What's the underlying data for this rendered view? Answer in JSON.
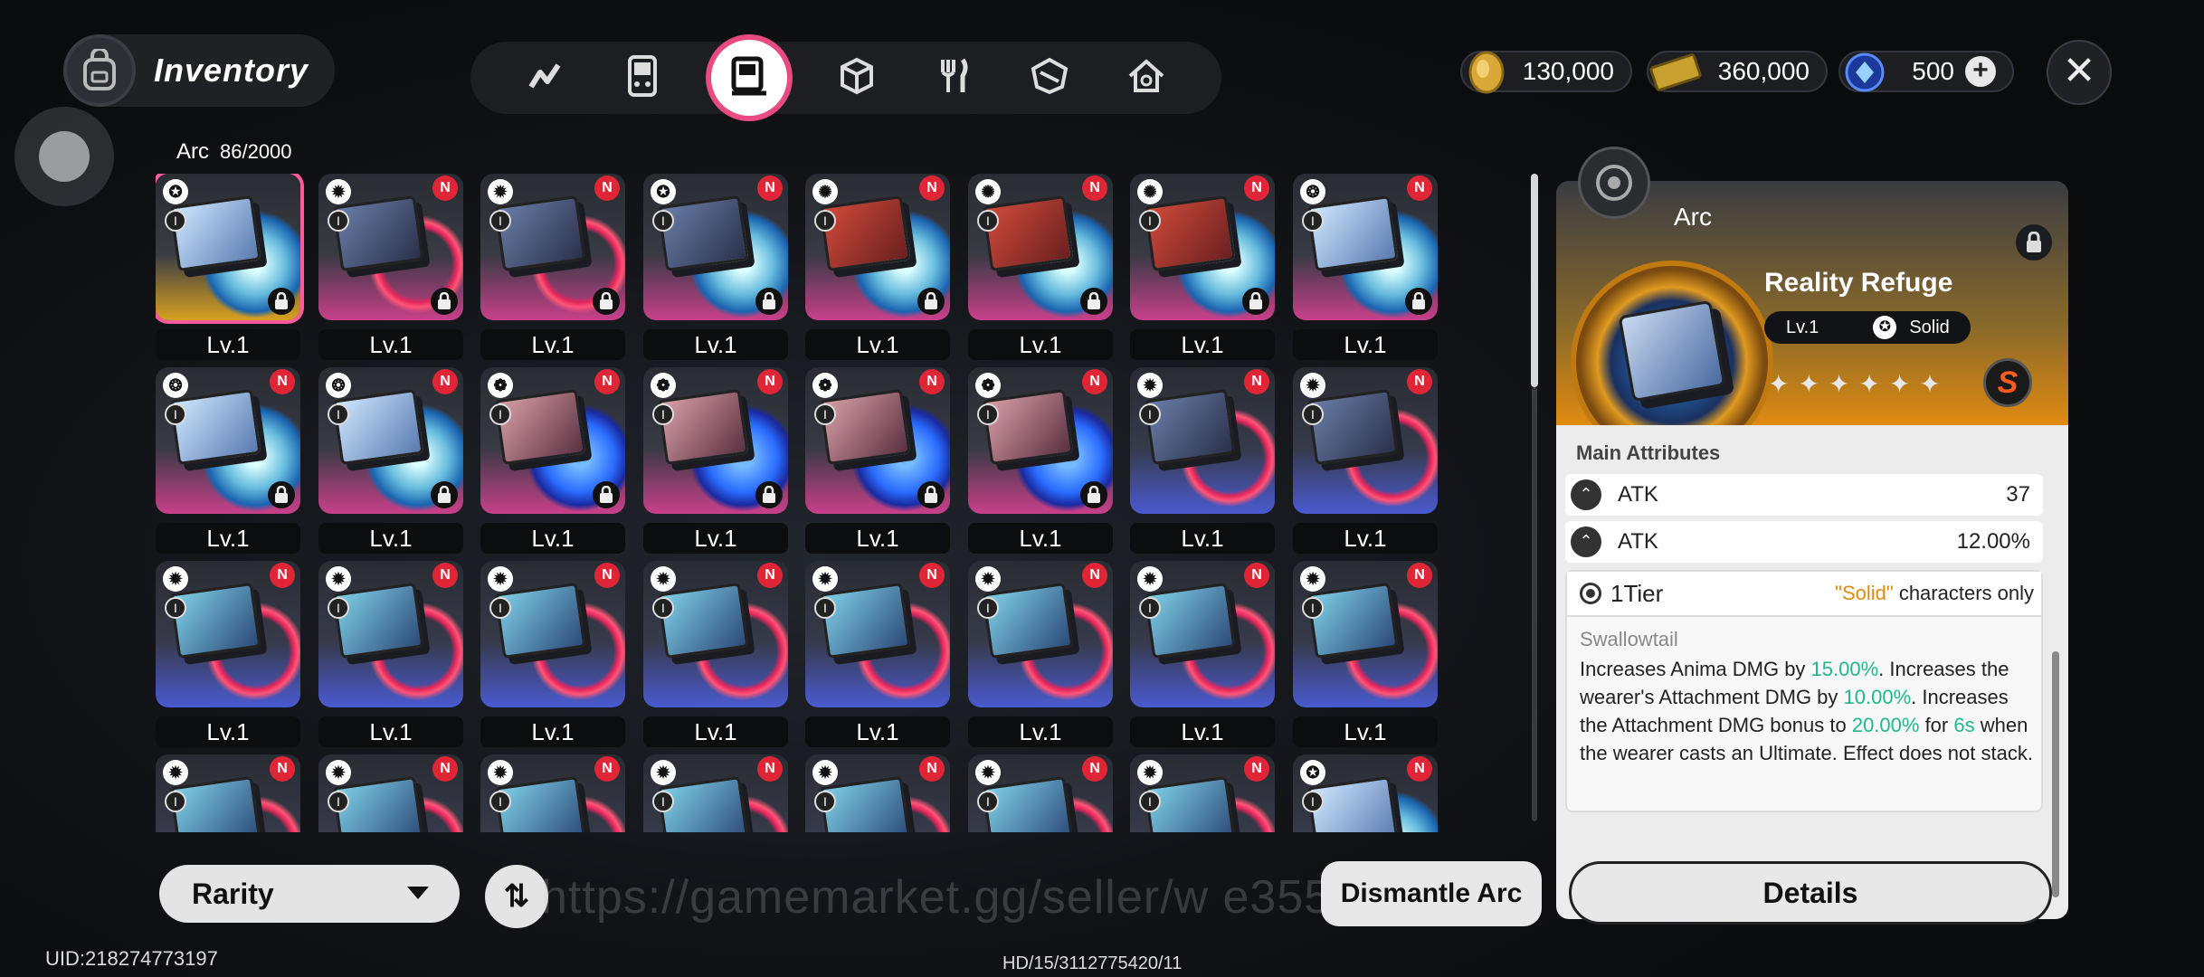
{
  "header": {
    "title": "Inventory",
    "tabs": [
      {
        "name": "tab-stats",
        "icon": "chart-icon",
        "active": false
      },
      {
        "name": "tab-devices",
        "icon": "gameboy-icon",
        "active": false
      },
      {
        "name": "tab-arc",
        "icon": "arc-icon",
        "active": true
      },
      {
        "name": "tab-materials",
        "icon": "cube-icon",
        "active": false
      },
      {
        "name": "tab-food",
        "icon": "fork-knife-icon",
        "active": false
      },
      {
        "name": "tab-items",
        "icon": "box-icon",
        "active": false
      },
      {
        "name": "tab-home",
        "icon": "house-icon",
        "active": false
      }
    ],
    "currencies": [
      {
        "name": "gold-coins",
        "value": "130,000",
        "icon": "coin-icon"
      },
      {
        "name": "tickets",
        "value": "360,000",
        "icon": "ticket-icon"
      },
      {
        "name": "crystals",
        "value": "500",
        "icon": "crystal-icon"
      }
    ],
    "plus_label": "+",
    "close_label": "✕"
  },
  "inventory": {
    "category": "Arc",
    "count": "86/2000",
    "rows": [
      [
        {
          "lv": "Lv.1",
          "frame": "gold",
          "art": "ice",
          "ring": "ice",
          "elem": "✪",
          "new": false,
          "lock": true,
          "selected": true
        },
        {
          "lv": "Lv.1",
          "frame": "pink",
          "art": "dark",
          "ring": "red",
          "elem": "✹",
          "new": true,
          "lock": true
        },
        {
          "lv": "Lv.1",
          "frame": "pink",
          "art": "dark",
          "ring": "red",
          "elem": "✹",
          "new": true,
          "lock": true
        },
        {
          "lv": "Lv.1",
          "frame": "pink",
          "art": "dark",
          "ring": "ice",
          "elem": "✪",
          "new": true,
          "lock": true
        },
        {
          "lv": "Lv.1",
          "frame": "pink",
          "art": "red",
          "ring": "ice",
          "elem": "✺",
          "new": true,
          "lock": true
        },
        {
          "lv": "Lv.1",
          "frame": "pink",
          "art": "red",
          "ring": "ice",
          "elem": "✺",
          "new": true,
          "lock": true
        },
        {
          "lv": "Lv.1",
          "frame": "pink",
          "art": "red",
          "ring": "ice",
          "elem": "✺",
          "new": true,
          "lock": true
        },
        {
          "lv": "Lv.1",
          "frame": "pink",
          "art": "ice",
          "ring": "ice",
          "elem": "❂",
          "new": true,
          "lock": true
        }
      ],
      [
        {
          "lv": "Lv.1",
          "frame": "pink",
          "art": "ice",
          "ring": "ice",
          "elem": "❂",
          "new": true,
          "lock": true
        },
        {
          "lv": "Lv.1",
          "frame": "pink",
          "art": "ice",
          "ring": "ice",
          "elem": "❂",
          "new": true,
          "lock": true
        },
        {
          "lv": "Lv.1",
          "frame": "pink",
          "art": "pink",
          "ring": "elec",
          "elem": "❁",
          "new": true,
          "lock": true
        },
        {
          "lv": "Lv.1",
          "frame": "pink",
          "art": "pink",
          "ring": "elec",
          "elem": "❁",
          "new": true,
          "lock": true
        },
        {
          "lv": "Lv.1",
          "frame": "pink",
          "art": "pink",
          "ring": "elec",
          "elem": "❁",
          "new": true,
          "lock": true
        },
        {
          "lv": "Lv.1",
          "frame": "pink",
          "art": "pink",
          "ring": "elec",
          "elem": "❁",
          "new": true,
          "lock": true
        },
        {
          "lv": "Lv.1",
          "frame": "blue",
          "art": "dark",
          "ring": "red",
          "elem": "✹",
          "new": true,
          "lock": false
        },
        {
          "lv": "Lv.1",
          "frame": "blue",
          "art": "dark",
          "ring": "red",
          "elem": "✹",
          "new": true,
          "lock": false
        }
      ],
      [
        {
          "lv": "Lv.1",
          "frame": "blue",
          "art": "teal",
          "ring": "red",
          "elem": "✹",
          "new": true,
          "lock": false
        },
        {
          "lv": "Lv.1",
          "frame": "blue",
          "art": "teal",
          "ring": "red",
          "elem": "✹",
          "new": true,
          "lock": false
        },
        {
          "lv": "Lv.1",
          "frame": "blue",
          "art": "teal",
          "ring": "red",
          "elem": "✹",
          "new": true,
          "lock": false
        },
        {
          "lv": "Lv.1",
          "frame": "blue",
          "art": "teal",
          "ring": "red",
          "elem": "✹",
          "new": true,
          "lock": false
        },
        {
          "lv": "Lv.1",
          "frame": "blue",
          "art": "teal",
          "ring": "red",
          "elem": "✹",
          "new": true,
          "lock": false
        },
        {
          "lv": "Lv.1",
          "frame": "blue",
          "art": "teal",
          "ring": "red",
          "elem": "✹",
          "new": true,
          "lock": false
        },
        {
          "lv": "Lv.1",
          "frame": "blue",
          "art": "teal",
          "ring": "red",
          "elem": "✹",
          "new": true,
          "lock": false
        },
        {
          "lv": "Lv.1",
          "frame": "blue",
          "art": "teal",
          "ring": "red",
          "elem": "✹",
          "new": true,
          "lock": false
        }
      ],
      [
        {
          "lv": "",
          "frame": "blue",
          "art": "teal",
          "ring": "red",
          "elem": "✹",
          "new": true,
          "lock": false
        },
        {
          "lv": "",
          "frame": "blue",
          "art": "teal",
          "ring": "red",
          "elem": "✹",
          "new": true,
          "lock": false
        },
        {
          "lv": "",
          "frame": "blue",
          "art": "teal",
          "ring": "red",
          "elem": "✹",
          "new": true,
          "lock": false
        },
        {
          "lv": "",
          "frame": "blue",
          "art": "teal",
          "ring": "red",
          "elem": "✹",
          "new": true,
          "lock": false
        },
        {
          "lv": "",
          "frame": "blue",
          "art": "teal",
          "ring": "red",
          "elem": "✹",
          "new": true,
          "lock": false
        },
        {
          "lv": "",
          "frame": "blue",
          "art": "teal",
          "ring": "red",
          "elem": "✹",
          "new": true,
          "lock": false
        },
        {
          "lv": "",
          "frame": "blue",
          "art": "teal",
          "ring": "red",
          "elem": "✹",
          "new": true,
          "lock": false
        },
        {
          "lv": "",
          "frame": "blue",
          "art": "ice",
          "ring": "ice",
          "elem": "✪",
          "new": true,
          "lock": false
        }
      ]
    ],
    "new_badge": "N",
    "tier_label": "I"
  },
  "footer": {
    "rarity_label": "Rarity",
    "sort_label": "⇅",
    "dismantle_label": "Dismantle Arc",
    "watermark": "https://gamemarket.gg/seller/w        e355",
    "uid": "UID:218274773197",
    "build": "HD/15/3112775420/11"
  },
  "detail": {
    "kind": "Arc",
    "name": "Reality Refuge",
    "level": "Lv.1",
    "element_icon": "✪",
    "element": "Solid",
    "stars": "✦✦✦✦✦✦",
    "rank_badge": "S",
    "main_attributes_label": "Main Attributes",
    "attributes": [
      {
        "name": "ATK",
        "value": "37"
      },
      {
        "name": "ATK",
        "value": "12.00%"
      }
    ],
    "tier": "1Tier",
    "restriction_highlight": "\"Solid\"",
    "restriction_text": " characters only",
    "effect_name": "Swallowtail",
    "effect": {
      "p1": "Increases Anima DMG by ",
      "v1": "15.00%",
      "p2": ". Increases the wearer's Attachment DMG by ",
      "v2": "10.00%",
      "p3": ". Increases the Attachment DMG bonus to ",
      "v3": "20.00%",
      "p4": " for ",
      "v4": "6s",
      "p5": " when the wearer casts an Ultimate. Effect does not stack."
    },
    "details_label": "Details"
  },
  "colors": {
    "accent_pink": "#e84b80",
    "rarity_gold": "#e08a10",
    "highlight_green": "#1fb88a",
    "new_red": "#e02636"
  }
}
